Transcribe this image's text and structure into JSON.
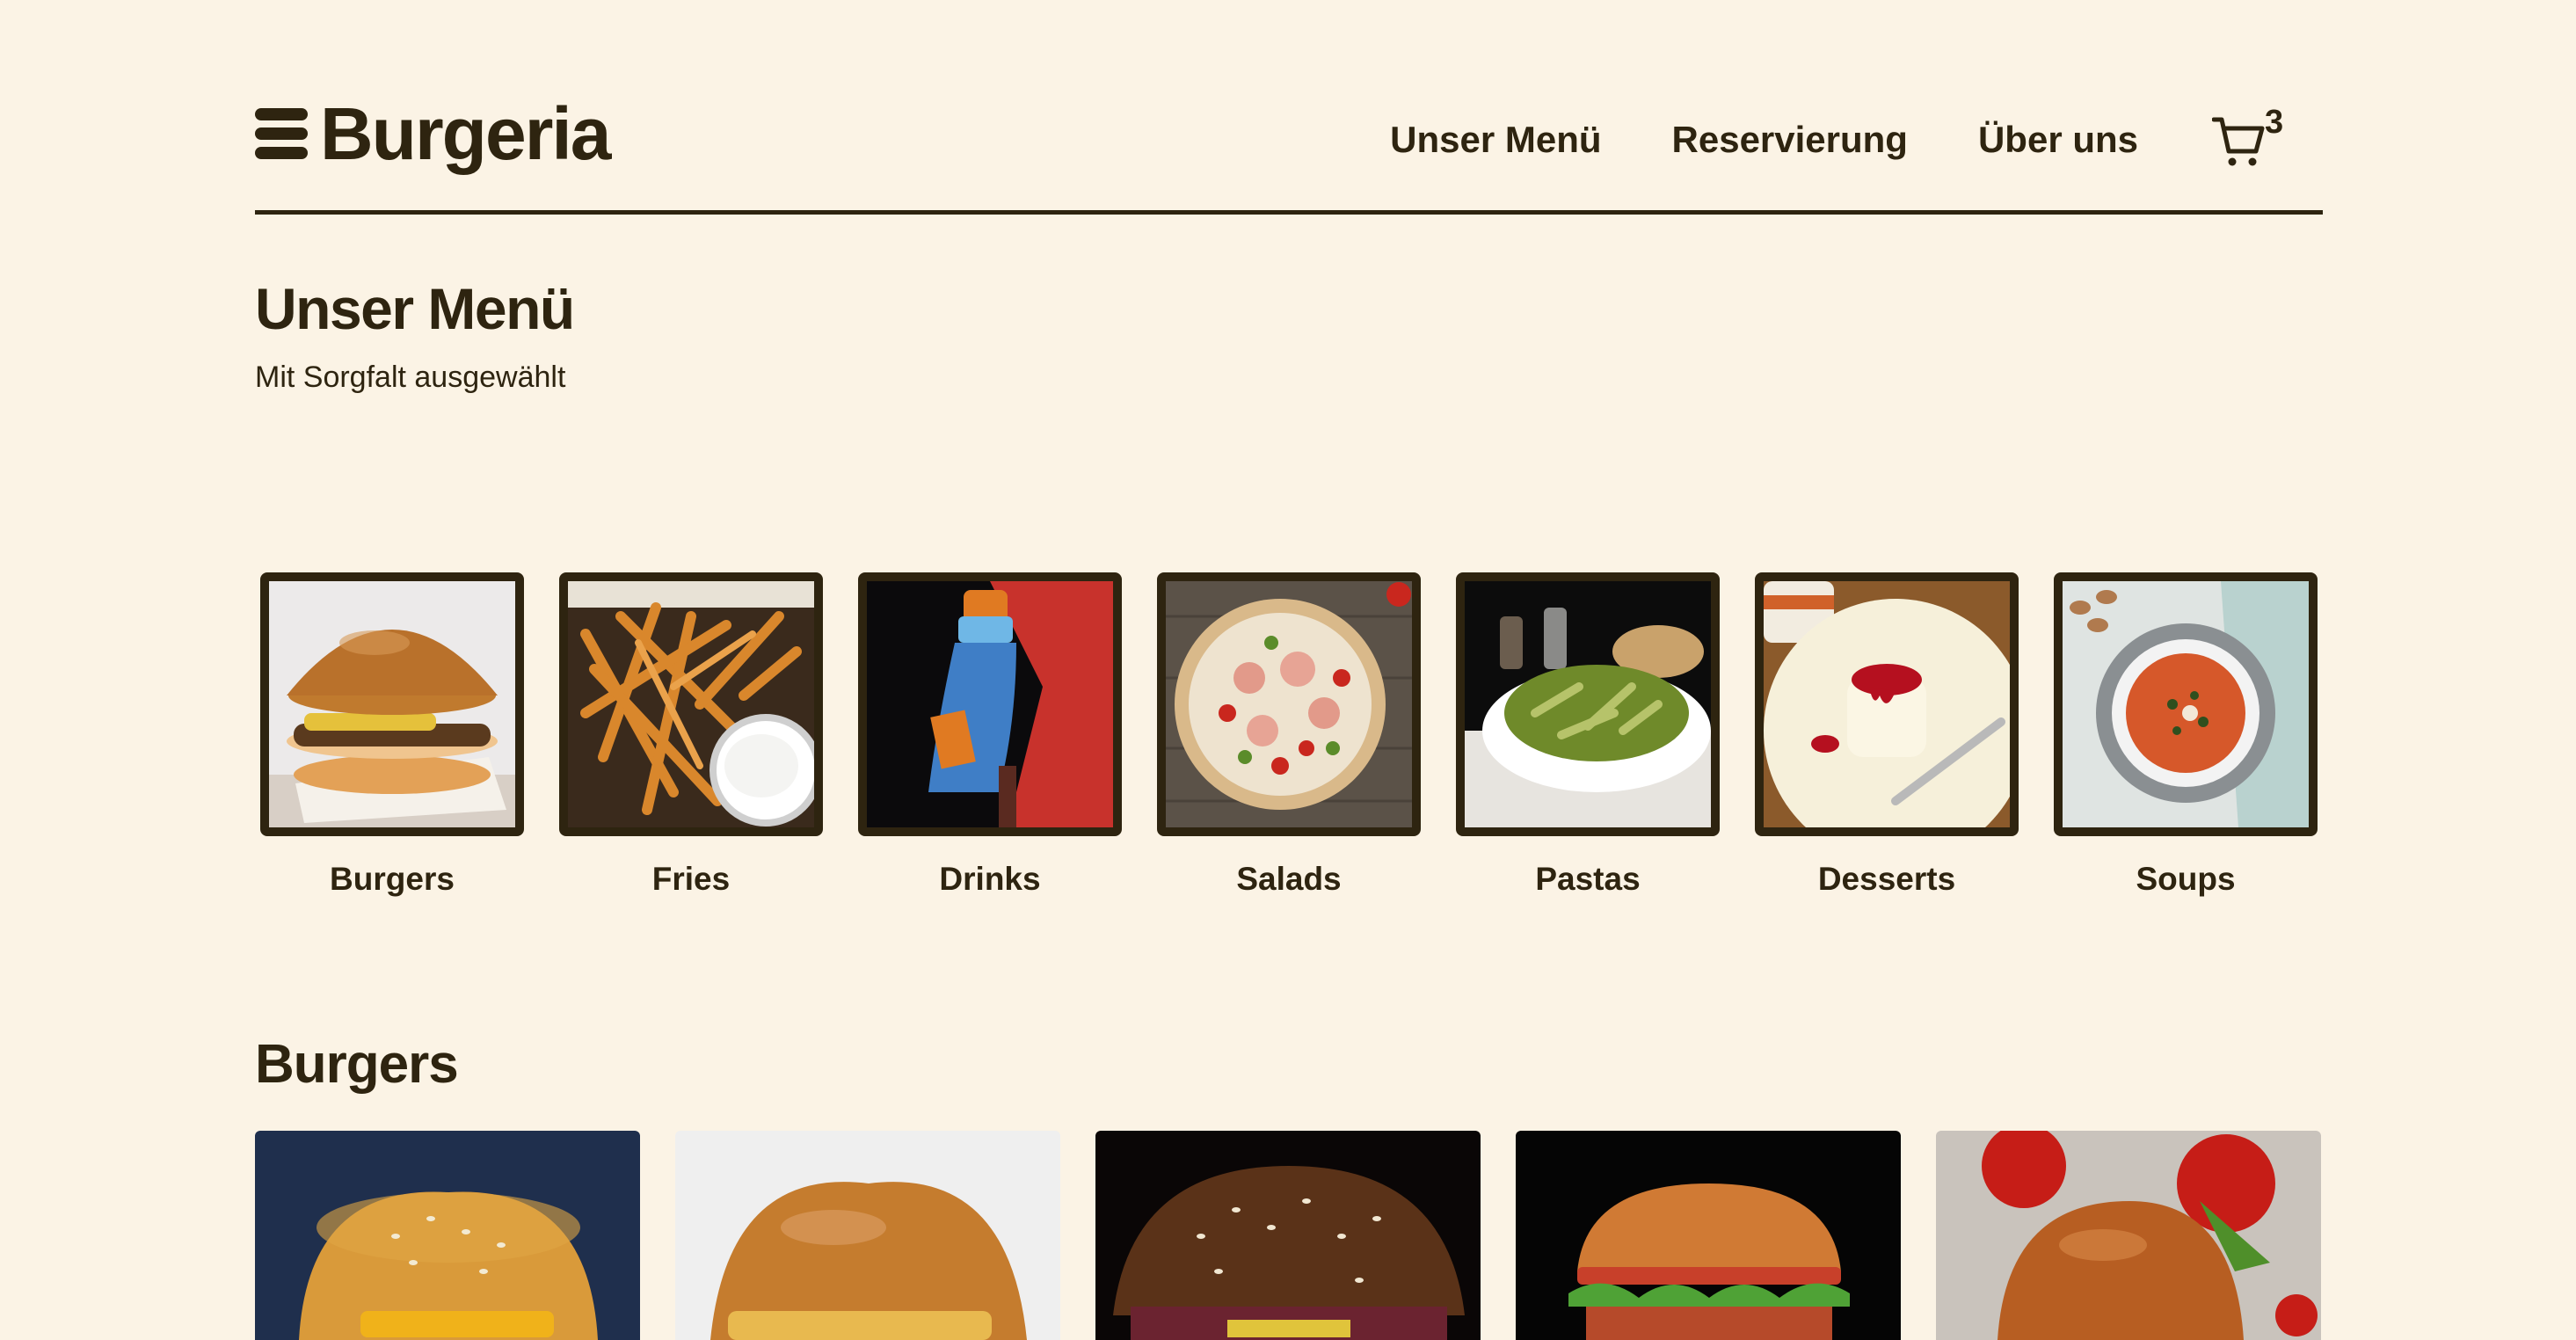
{
  "header": {
    "logo_text": "Burgeria",
    "nav": [
      "Unser Menü",
      "Reservierung",
      "Über uns"
    ],
    "cart_count": "3"
  },
  "intro": {
    "title": "Unser Menü",
    "subtitle": "Mit Sorgfalt ausgewählt"
  },
  "categories": [
    {
      "label": "Burgers",
      "icon": "burger-photo"
    },
    {
      "label": "Fries",
      "icon": "fries-photo"
    },
    {
      "label": "Drinks",
      "icon": "drink-photo"
    },
    {
      "label": "Salads",
      "icon": "salad-photo"
    },
    {
      "label": "Pastas",
      "icon": "pasta-photo"
    },
    {
      "label": "Desserts",
      "icon": "dessert-photo"
    },
    {
      "label": "Soups",
      "icon": "soup-photo"
    }
  ],
  "section": {
    "title": "Burgers"
  },
  "colors": {
    "background": "#fbf3e5",
    "text": "#2e2410"
  }
}
